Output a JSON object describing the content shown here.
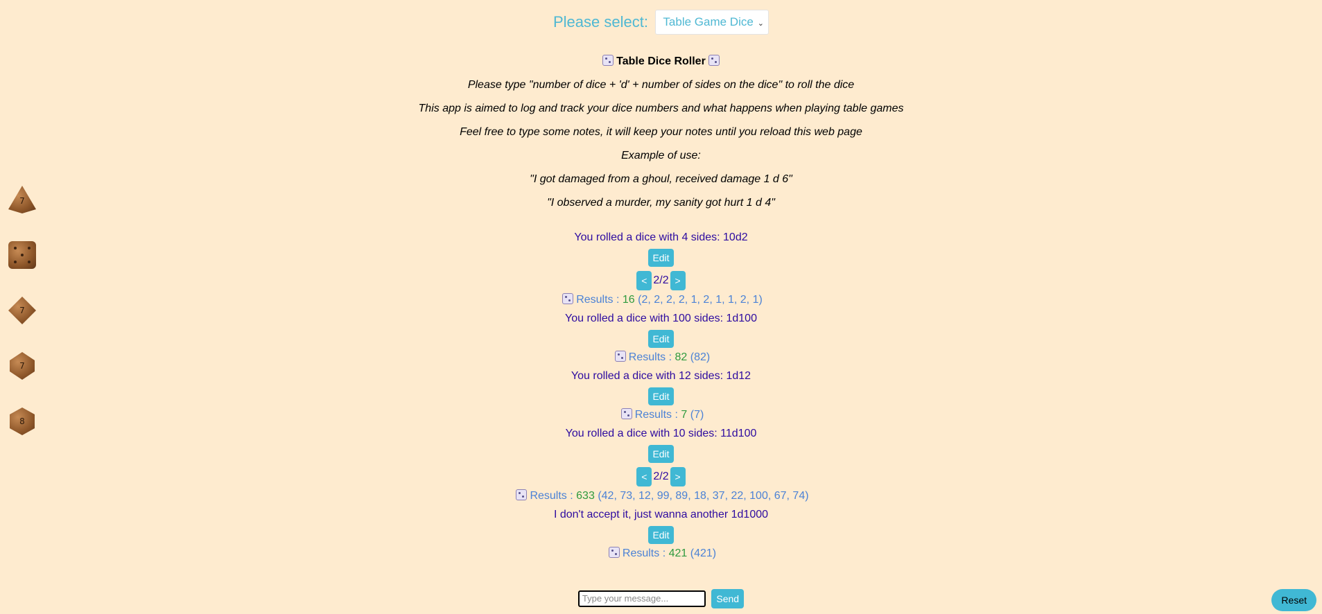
{
  "header": {
    "select_label": "Please select:",
    "selected_option": "Table Game Dice"
  },
  "intro": {
    "title": "Table Dice Roller",
    "lines": [
      "Please type \"number of dice + 'd' + number of sides on the dice\" to roll the dice",
      "This app is aimed to log and track your dice numbers and what happens when playing table games",
      "Feel free to type some notes, it will keep your notes until you reload this web page",
      "Example of use:",
      "\"I got damaged from a ghoul, received damage 1 d 6\"",
      "\"I observed a murder, my sanity got hurt 1 d 4\""
    ]
  },
  "sidebar": {
    "dice": [
      {
        "name": "d4-die-icon",
        "label": "7"
      },
      {
        "name": "d6-die-icon",
        "label": ""
      },
      {
        "name": "d8-die-icon",
        "label": "7"
      },
      {
        "name": "d10-die-icon",
        "label": "7"
      },
      {
        "name": "d20-die-icon",
        "label": "8"
      }
    ]
  },
  "log": {
    "edit_label": "Edit",
    "results_label": "Results :",
    "prev_label": "<",
    "next_label": ">",
    "entries": [
      {
        "message": "You rolled a dice with 4 sides: 10d2",
        "page": "2/2",
        "total": "16",
        "rolls": "(2, 2, 2, 2, 1, 2, 1, 1, 2, 1)"
      },
      {
        "message": "You rolled a dice with 100 sides: 1d100",
        "page": "",
        "total": "82",
        "rolls": "(82)"
      },
      {
        "message": "You rolled a dice with 12 sides: 1d12",
        "page": "",
        "total": "7",
        "rolls": "(7)"
      },
      {
        "message": "You rolled a dice with 10 sides: 11d100",
        "page": "2/2",
        "total": "633",
        "rolls": "(42, 73, 12, 99, 89, 18, 37, 22, 100, 67, 74)"
      },
      {
        "message": "I don't accept it, just wanna another 1d1000",
        "page": "",
        "total": "421",
        "rolls": "(421)"
      }
    ]
  },
  "composer": {
    "placeholder": "Type your message...",
    "send_label": "Send"
  },
  "reset_label": "Reset",
  "colors": {
    "background": "#feebcf",
    "accent": "#40b8d4",
    "message": "#2d0ba0",
    "results": "#4b82d6",
    "total": "#2e9a3e"
  }
}
